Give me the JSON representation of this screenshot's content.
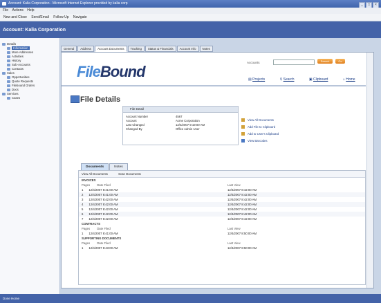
{
  "window": {
    "title": "Account: Kalia Corporation - Microsoft Internet Explorer provided by kalia corp"
  },
  "menu": [
    "File",
    "Actions",
    "Help"
  ],
  "toolbar": [
    "New and Close",
    "Send/Email",
    "Follow Up",
    "Navigate"
  ],
  "app_header": {
    "title": "Account: Kalia Corporation"
  },
  "sidebar": {
    "items": [
      {
        "label": "Details",
        "indent": 0
      },
      {
        "label": "Information",
        "indent": 1,
        "selected": true
      },
      {
        "label": "More Addresses",
        "indent": 1
      },
      {
        "label": "Activities",
        "indent": 1
      },
      {
        "label": "History",
        "indent": 1
      },
      {
        "label": "Sub-Accounts",
        "indent": 1
      },
      {
        "label": "Contacts",
        "indent": 1
      },
      {
        "label": "Sales",
        "indent": 0
      },
      {
        "label": "Opportunities",
        "indent": 1
      },
      {
        "label": "Quote Requests",
        "indent": 1
      },
      {
        "label": "Filebound Orders",
        "indent": 1
      },
      {
        "label": "Docs",
        "indent": 1
      },
      {
        "label": "Services",
        "indent": 0
      },
      {
        "label": "Cases",
        "indent": 1
      }
    ]
  },
  "tabs": [
    "General",
    "Address",
    "Account Documents",
    "Tracking",
    "Status & Financials",
    "Account Info",
    "Notes"
  ],
  "content": {
    "logo": {
      "prefix": "File",
      "main": "Bound"
    },
    "accounts_label": "Accounts",
    "search_buttons": [
      "Search",
      "Go"
    ],
    "nav": [
      "Projects",
      "Search",
      "Clipboard",
      "Home"
    ],
    "page_title": "File Details",
    "detail_header": "File Detail",
    "detail": [
      {
        "key": "Account Number",
        "value": "4567"
      },
      {
        "key": "Account",
        "value": "Acme Corporation"
      },
      {
        "key": "Last Changed",
        "value": "12/4/2007 9:19:00 AM"
      },
      {
        "key": "Changed By",
        "value": "Office Admin User"
      }
    ],
    "actions": [
      "View All Documents",
      "Add File to Clipboard",
      "Add to User's Clipboard",
      "View Barcodes"
    ],
    "doc_tabs": [
      "Documents",
      "Notes"
    ],
    "doc_toolbar": [
      "View All Documents",
      "Scan Documents"
    ],
    "doc_groups": [
      {
        "name": "INVOICES",
        "header": [
          "Pages",
          "Date Filed",
          "Last View"
        ],
        "rows": [
          {
            "n": "1",
            "filed": "12/4/2007 8:41:00 AM",
            "view": "12/4/2007 8:42:00 AM"
          },
          {
            "n": "2",
            "filed": "12/4/2007 8:41:00 AM",
            "view": "12/4/2007 8:42:00 AM"
          },
          {
            "n": "3",
            "filed": "12/4/2007 8:42:00 AM",
            "view": "12/4/2007 8:42:00 AM"
          },
          {
            "n": "4",
            "filed": "12/4/2007 8:42:00 AM",
            "view": "12/4/2007 8:42:00 AM"
          },
          {
            "n": "5",
            "filed": "12/4/2007 8:42:00 AM",
            "view": "12/4/2007 8:42:00 AM"
          },
          {
            "n": "6",
            "filed": "12/4/2007 8:42:00 AM",
            "view": "12/4/2007 8:42:00 AM"
          },
          {
            "n": "7",
            "filed": "12/4/2007 8:42:00 AM",
            "view": "12/4/2007 8:42:00 AM"
          }
        ]
      },
      {
        "name": "CONTRACTS",
        "header": [
          "Pages",
          "Date Filed",
          "Last View"
        ],
        "rows": [
          {
            "n": "1",
            "filed": "12/4/2007 8:41:00 AM",
            "view": "12/4/2007 8:50:00 AM"
          }
        ]
      },
      {
        "name": "SUPPORTING DOCUMENTS",
        "header": [
          "Pages",
          "Date Filed",
          "Last View"
        ],
        "rows": [
          {
            "n": "1",
            "filed": "12/4/2007 8:43:00 AM",
            "view": "12/4/2007 8:50:00 AM"
          }
        ]
      }
    ]
  },
  "status": "Done Home"
}
